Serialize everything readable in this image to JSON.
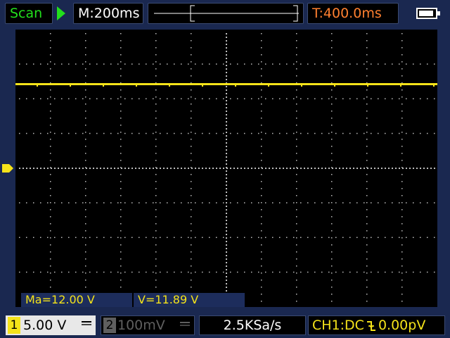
{
  "status": {
    "mode": "Scan",
    "timebase": "M:200ms",
    "trigger_time": "T:400.0ms"
  },
  "measurements": {
    "max": "Ma=12.00 V",
    "avg": "V=11.89 V"
  },
  "channels": {
    "ch1": {
      "number": "1",
      "scale": "5.00 V"
    },
    "ch2": {
      "number": "2",
      "scale": "100mV"
    }
  },
  "acquisition": {
    "sample_rate": "2.5KSa/s"
  },
  "trigger": {
    "source_coupling": "CH1:DC",
    "level": "0.00pV"
  },
  "trace": {
    "level_fraction_of_screen_height": 0.195
  },
  "colors": {
    "ch1": "#f5e31a",
    "ch2": "#5f5f5f",
    "scan": "#22e01c",
    "trigger_time": "#ff8030",
    "grid": "#bdbdbd",
    "chrome": "#1a2850"
  },
  "icons": {
    "run_state": "play-triangle-icon",
    "battery": "battery-icon",
    "trigger_edge": "falling-edge-icon",
    "coupling": "dc-coupling-icon"
  }
}
